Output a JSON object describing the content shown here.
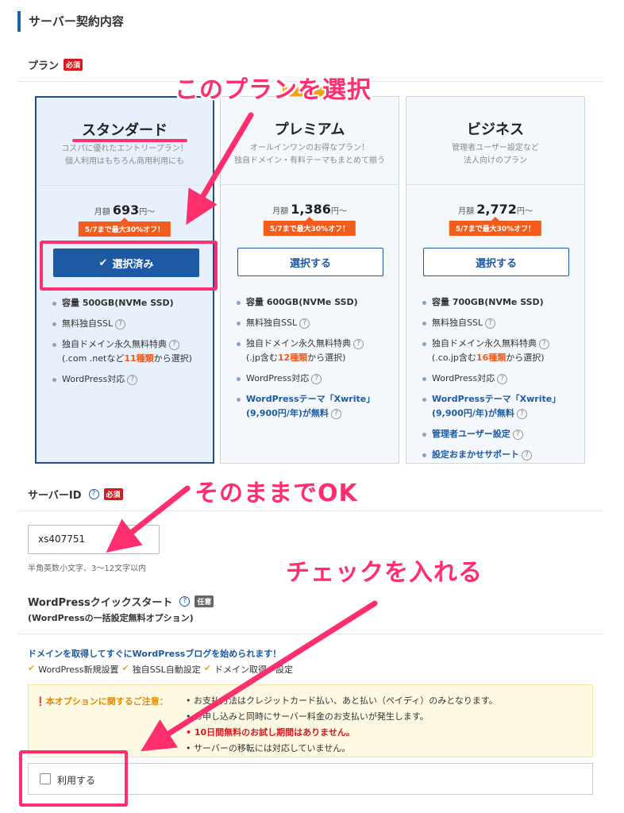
{
  "section_title": "サーバー契約内容",
  "plan_field": {
    "label": "プラン",
    "required": "必須"
  },
  "plans": [
    {
      "name": "スタンダード",
      "desc_line1": "コスパに優れたエントリープラン！",
      "desc_line2": "個人利用はもちろん商用利用にも",
      "price_prefix": "月額",
      "price": "693",
      "price_suffix": "円〜",
      "promo": "5/7まで最大30%オフ！",
      "button": "選択済み",
      "selected": true,
      "features": {
        "capacity_label": "容量",
        "capacity_value": "500GB(NVMe SSD)",
        "ssl": "無料独自SSL",
        "domain": "独自ドメイン永久無料特典",
        "domain_detail_pre": "(.com .netなど",
        "domain_count": "11種類",
        "domain_detail_post": "から選択)",
        "wordpress": "WordPress対応"
      }
    },
    {
      "name": "プレミアム",
      "desc_line1": "オールインワンのお得なプラン！",
      "desc_line2": "独自ドメイン・有料テーマもまとめて揃う",
      "price_prefix": "月額",
      "price": "1,386",
      "price_suffix": "円〜",
      "promo": "5/7まで最大30%オフ！",
      "button": "選択する",
      "selected": false,
      "features": {
        "capacity_label": "容量",
        "capacity_value": "600GB(NVMe SSD)",
        "ssl": "無料独自SSL",
        "domain": "独自ドメイン永久無料特典",
        "domain_detail_pre": "(.jp含む",
        "domain_count": "12種類",
        "domain_detail_post": "から選択)",
        "wordpress": "WordPress対応",
        "theme_line1": "WordPressテーマ「Xwrite」",
        "theme_line2": "(9,900円/年)が無料"
      }
    },
    {
      "name": "ビジネス",
      "desc_line1": "管理者ユーザー設定など",
      "desc_line2": "法人向けのプラン",
      "price_prefix": "月額",
      "price": "2,772",
      "price_suffix": "円〜",
      "promo": "5/7まで最大30%オフ！",
      "button": "選択する",
      "selected": false,
      "features": {
        "capacity_label": "容量",
        "capacity_value": "700GB(NVMe SSD)",
        "ssl": "無料独自SSL",
        "domain": "独自ドメイン永久無料特典",
        "domain_detail_pre": "(.co.jp含む",
        "domain_count": "16種類",
        "domain_detail_post": "から選択)",
        "wordpress": "WordPress対応",
        "theme_line1": "WordPressテーマ「Xwrite」",
        "theme_line2": "(9,900円/年)が無料",
        "admin": "管理者ユーザー設定",
        "support": "設定おまかせサポート"
      }
    }
  ],
  "server_id": {
    "label": "サーバーID",
    "required": "必須",
    "value": "xs407751",
    "hint": "半角英数小文字、3〜12文字以内"
  },
  "quickstart": {
    "label": "WordPressクイックスタート",
    "tag": "任意",
    "sub": "(WordPressの一括設定無料オプション)",
    "promo": "ドメインを取得してすぐにWordPressブログを始められます！",
    "checks": [
      "WordPress新規設置",
      "独自SSL自動設定",
      "ドメイン取得・設定"
    ],
    "notice_title": "本オプションに関するご注意：",
    "notice_items": [
      "お支払方法はクレジットカード払い、あと払い（ペイディ）のみとなります。",
      "お申し込みと同時にサーバー料金のお支払いが発生します。",
      "10日間無料のお試し期間はありません。",
      "サーバーの移転には対応していません。"
    ],
    "checkbox_label": "利用する"
  },
  "annotations": {
    "select_plan": "このプランを選択",
    "as_is": "そのままでOK",
    "check_it": "チェックを入れる"
  },
  "colors": {
    "accent": "#1d5aa3",
    "annotation": "#ff2f6e",
    "promo": "#f25c1c",
    "required": "#d71920"
  }
}
